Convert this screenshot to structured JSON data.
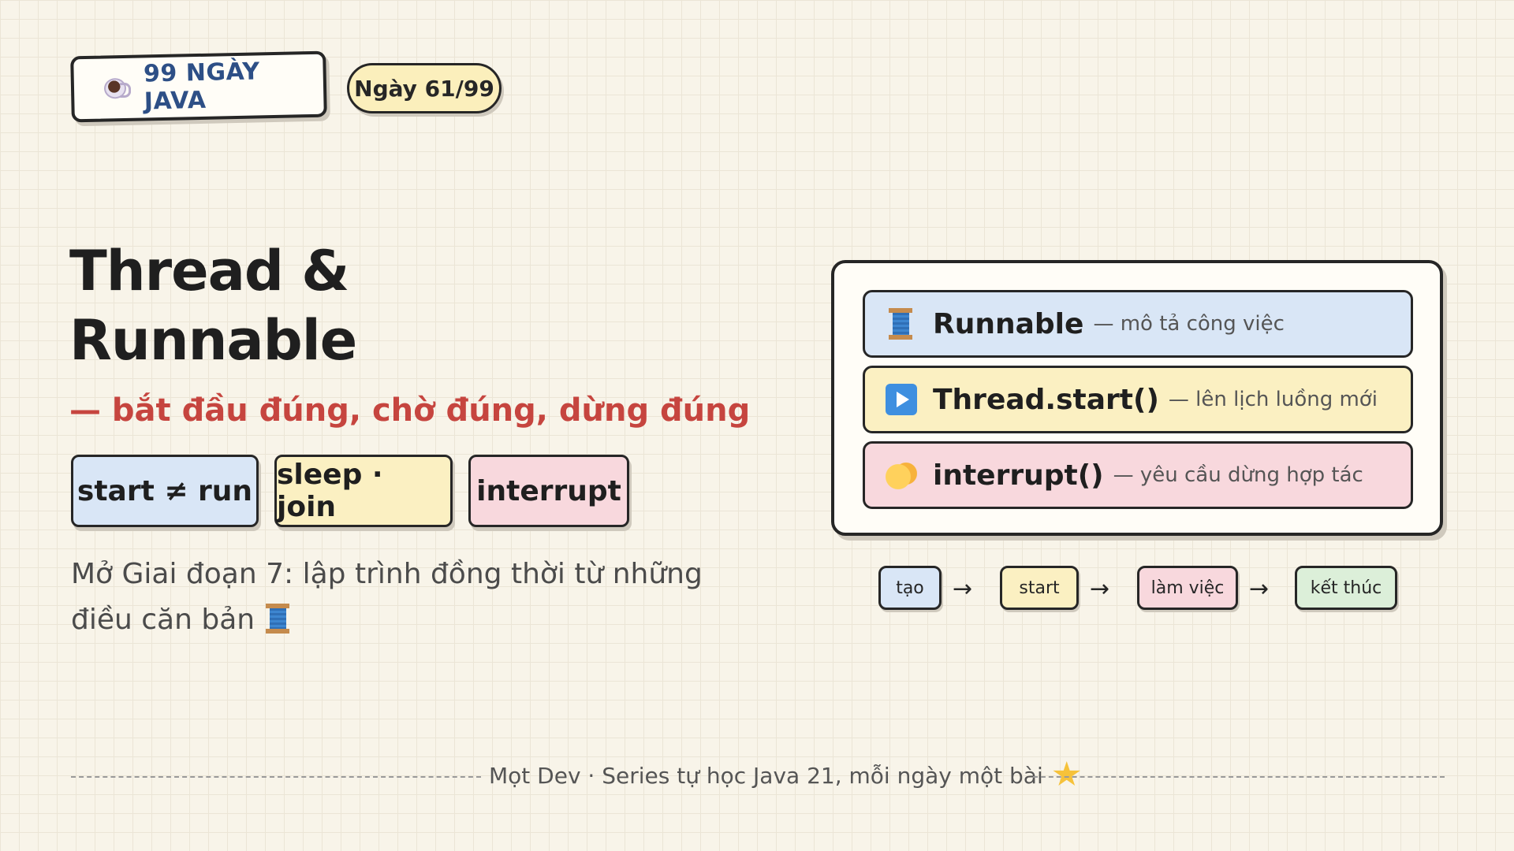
{
  "header": {
    "brand": "99 NGÀY JAVA",
    "brand_icon": "coffee-mug-icon",
    "day_label": "Ngày 61/99"
  },
  "hero": {
    "title_line1": "Thread &",
    "title_line2": "Runnable",
    "subtitle": "— bắt đầu đúng, chờ đúng, dừng đúng",
    "tags": [
      {
        "label": "start ≠ run",
        "color": "#d9e6f6"
      },
      {
        "label": "sleep · join",
        "color": "#fbf0c2"
      },
      {
        "label": "interrupt",
        "color": "#f8d8dd"
      }
    ],
    "description": "Mở Giai đoạn 7: lập trình đồng thời từ những điều căn bản",
    "description_icon": "thread-spool-icon"
  },
  "panel": {
    "rows": [
      {
        "icon": "thread-spool-icon",
        "title": "Runnable",
        "desc": "— mô tả công việc",
        "color": "#d9e6f6"
      },
      {
        "icon": "play-button-icon",
        "title": "Thread.start()",
        "desc": "— lên lịch luồng mới",
        "color": "#fbf0c2"
      },
      {
        "icon": "handshake-icon",
        "title": "interrupt()",
        "desc": "— yêu cầu dừng hợp tác",
        "color": "#f8d8dd"
      }
    ]
  },
  "flow": {
    "steps": [
      "tạo",
      "start",
      "làm việc",
      "kết thúc"
    ],
    "arrow": "→"
  },
  "footer": {
    "text": "Mọt Dev · Series tự học Java 21, mỗi ngày một bài",
    "icon": "star-icon"
  }
}
